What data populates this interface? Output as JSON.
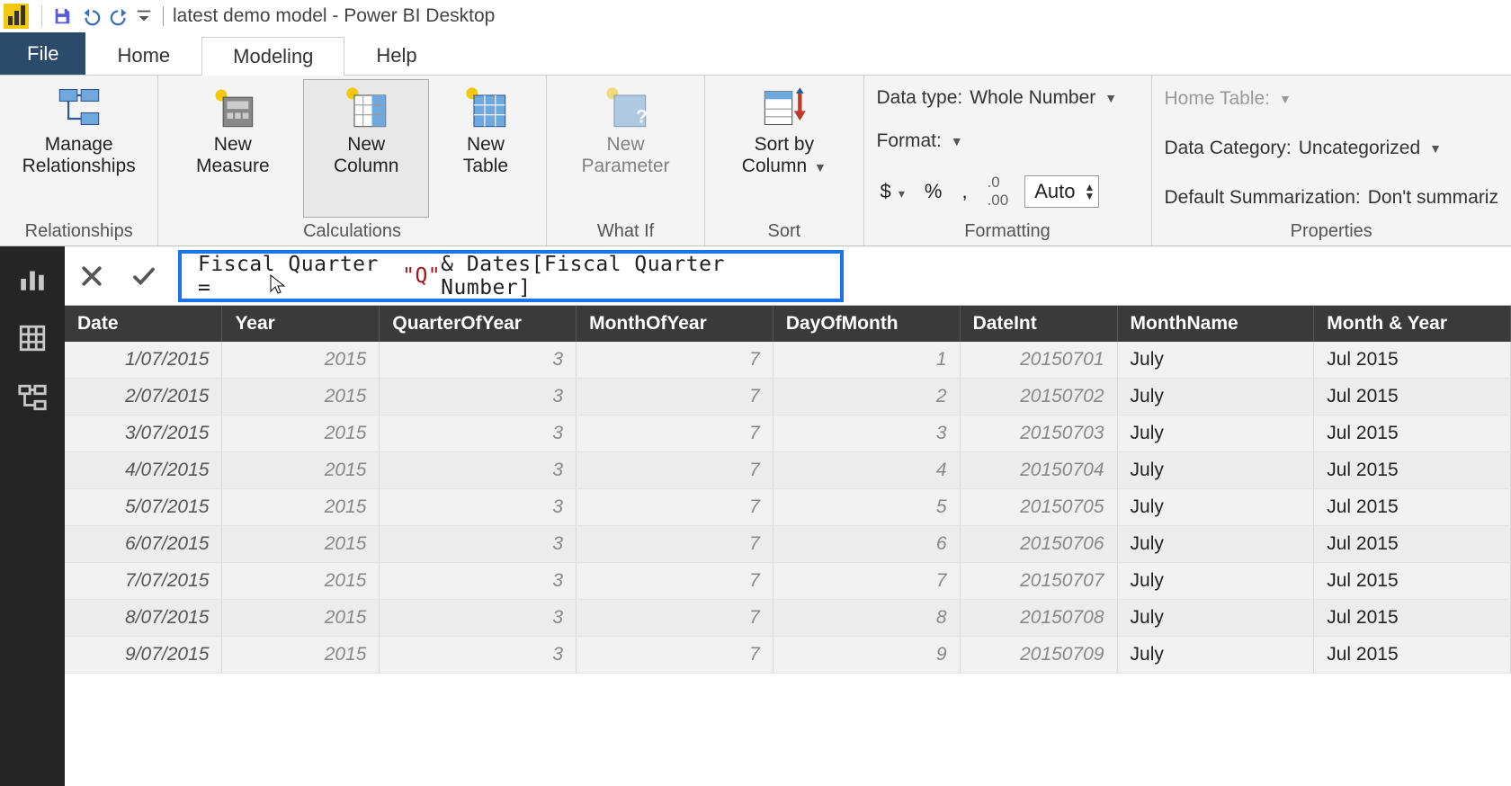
{
  "title": "latest demo model - Power BI Desktop",
  "tabs": {
    "file": "File",
    "home": "Home",
    "modeling": "Modeling",
    "help": "Help"
  },
  "ribbon": {
    "relationships": {
      "manage": "Manage Relationships",
      "group": "Relationships"
    },
    "calc": {
      "newMeasure": "New Measure",
      "newColumn": "New Column",
      "newTable": "New Table",
      "group": "Calculations"
    },
    "whatif": {
      "newParameter": "New Parameter",
      "group": "What If"
    },
    "sort": {
      "sortBy": "Sort by Column",
      "group": "Sort"
    },
    "formatting": {
      "dataTypeLabel": "Data type:",
      "dataTypeValue": "Whole Number",
      "formatLabel": "Format:",
      "decimalsValue": "Auto",
      "group": "Formatting"
    },
    "properties": {
      "homeTable": "Home Table:",
      "dataCategoryLabel": "Data Category:",
      "dataCategoryValue": "Uncategorized",
      "defaultSummLabel": "Default Summarization:",
      "defaultSummValue": "Don't summariz",
      "group": "Properties"
    }
  },
  "formula": {
    "prefix": "Fiscal Quarter = ",
    "str": "\"Q\"",
    "suffix": " & Dates[Fiscal Quarter Number]"
  },
  "grid": {
    "headers": [
      "Date",
      "Year",
      "QuarterOfYear",
      "MonthOfYear",
      "DayOfMonth",
      "DateInt",
      "MonthName",
      "Month & Year"
    ],
    "rows": [
      {
        "date": "1/07/2015",
        "year": "2015",
        "q": "3",
        "m": "7",
        "d": "1",
        "di": "20150701",
        "mn": "July",
        "my": "Jul 2015"
      },
      {
        "date": "2/07/2015",
        "year": "2015",
        "q": "3",
        "m": "7",
        "d": "2",
        "di": "20150702",
        "mn": "July",
        "my": "Jul 2015"
      },
      {
        "date": "3/07/2015",
        "year": "2015",
        "q": "3",
        "m": "7",
        "d": "3",
        "di": "20150703",
        "mn": "July",
        "my": "Jul 2015"
      },
      {
        "date": "4/07/2015",
        "year": "2015",
        "q": "3",
        "m": "7",
        "d": "4",
        "di": "20150704",
        "mn": "July",
        "my": "Jul 2015"
      },
      {
        "date": "5/07/2015",
        "year": "2015",
        "q": "3",
        "m": "7",
        "d": "5",
        "di": "20150705",
        "mn": "July",
        "my": "Jul 2015"
      },
      {
        "date": "6/07/2015",
        "year": "2015",
        "q": "3",
        "m": "7",
        "d": "6",
        "di": "20150706",
        "mn": "July",
        "my": "Jul 2015"
      },
      {
        "date": "7/07/2015",
        "year": "2015",
        "q": "3",
        "m": "7",
        "d": "7",
        "di": "20150707",
        "mn": "July",
        "my": "Jul 2015"
      },
      {
        "date": "8/07/2015",
        "year": "2015",
        "q": "3",
        "m": "7",
        "d": "8",
        "di": "20150708",
        "mn": "July",
        "my": "Jul 2015"
      },
      {
        "date": "9/07/2015",
        "year": "2015",
        "q": "3",
        "m": "7",
        "d": "9",
        "di": "20150709",
        "mn": "July",
        "my": "Jul 2015"
      }
    ]
  }
}
